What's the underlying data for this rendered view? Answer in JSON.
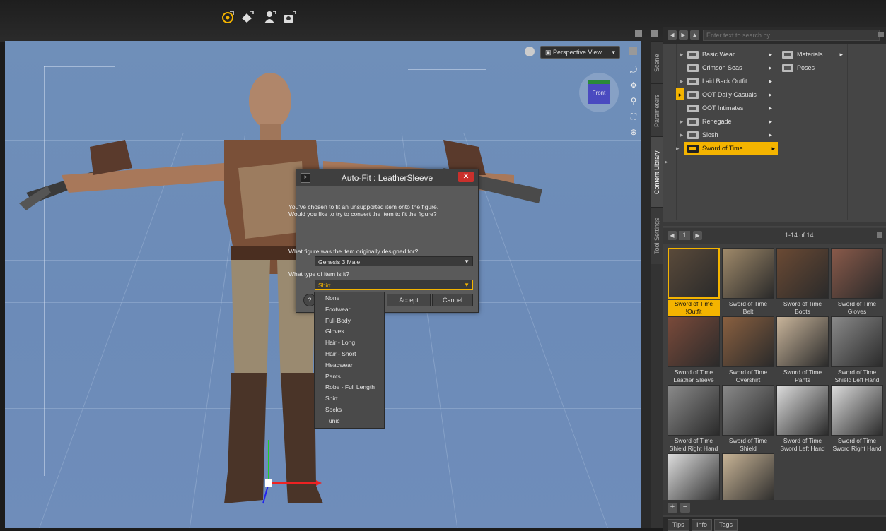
{
  "toolbar": {
    "icons": [
      "universal-tool-icon",
      "node-weight-icon",
      "figure-icon",
      "camera-icon"
    ]
  },
  "viewport": {
    "view_label": "Perspective View",
    "cube_label": "Front"
  },
  "side_tabs": [
    "Scene",
    "Parameters",
    "Content Library",
    "Tool Settings"
  ],
  "content_library": {
    "search_placeholder": "Enter text to search by...",
    "tree_col1": [
      {
        "label": "Basic Wear",
        "has_arrow": true
      },
      {
        "label": "Crimson Seas",
        "has_arrow": false
      },
      {
        "label": "Laid Back Outfit",
        "has_arrow": true
      },
      {
        "label": "OOT Daily Casuals",
        "has_arrow": true
      },
      {
        "label": "OOT Intimates",
        "has_arrow": false
      },
      {
        "label": "Renegade",
        "has_arrow": true
      },
      {
        "label": "Slosh",
        "has_arrow": true
      },
      {
        "label": "Sword of Time",
        "has_arrow": true
      }
    ],
    "tree_col2": [
      {
        "label": "Materials"
      },
      {
        "label": "Poses"
      }
    ],
    "page_number": "1",
    "result_count": "1-14 of 14",
    "items": [
      {
        "line1": "Sword of Time",
        "line2": "!Outfit",
        "color": "#5a4a3a"
      },
      {
        "line1": "Sword of Time",
        "line2": "Belt",
        "color": "#a08a6a"
      },
      {
        "line1": "Sword of Time",
        "line2": "Boots",
        "color": "#6b4a34"
      },
      {
        "line1": "Sword of Time",
        "line2": "Gloves",
        "color": "#8a5a4a"
      },
      {
        "line1": "Sword of Time",
        "line2": "Leather Sleeve",
        "color": "#7a4a3a"
      },
      {
        "line1": "Sword of Time",
        "line2": "Overshirt",
        "color": "#8a6040"
      },
      {
        "line1": "Sword of Time",
        "line2": "Pants",
        "color": "#c8b49a"
      },
      {
        "line1": "Sword of Time",
        "line2": "Shield Left Hand",
        "color": "#8a8a8a"
      },
      {
        "line1": "Sword of Time",
        "line2": "Shield Right Hand",
        "color": "#8a8a8a"
      },
      {
        "line1": "Sword of Time",
        "line2": "Shield",
        "color": "#8a8a8a"
      },
      {
        "line1": "Sword of Time",
        "line2": "Sword Left Hand",
        "color": "#dcdcdc"
      },
      {
        "line1": "Sword of Time",
        "line2": "Sword Right Hand",
        "color": "#dcdcdc"
      },
      {
        "line1": "",
        "line2": "",
        "color": "#dcdcdc"
      },
      {
        "line1": "",
        "line2": "",
        "color": "#c8b496"
      }
    ],
    "bottom_tabs": [
      "Tips",
      "Info",
      "Tags"
    ]
  },
  "dialog": {
    "title": "Auto-Fit : LeatherSleeve",
    "message_line1": "You've chosen to fit an unsupported item onto the figure.",
    "message_line2": "Would you like to try to convert the item to fit the figure?",
    "q1": "What figure was the item originally designed for?",
    "q1_value": "Genesis 3 Male",
    "q2": "What type of item is it?",
    "q2_value": "Shirt",
    "accept": "Accept",
    "cancel": "Cancel",
    "help_icon": "?",
    "options": [
      "None",
      "Footwear",
      "Full-Body",
      "Gloves",
      "Hair - Long",
      "Hair - Short",
      "Headwear",
      "Pants",
      "Robe - Full Length",
      "Shirt",
      "Socks",
      "Tunic"
    ]
  },
  "colors": {
    "accent": "#f4b400",
    "viewport_bg": "#6f8fb9",
    "close_red": "#c9302c"
  }
}
